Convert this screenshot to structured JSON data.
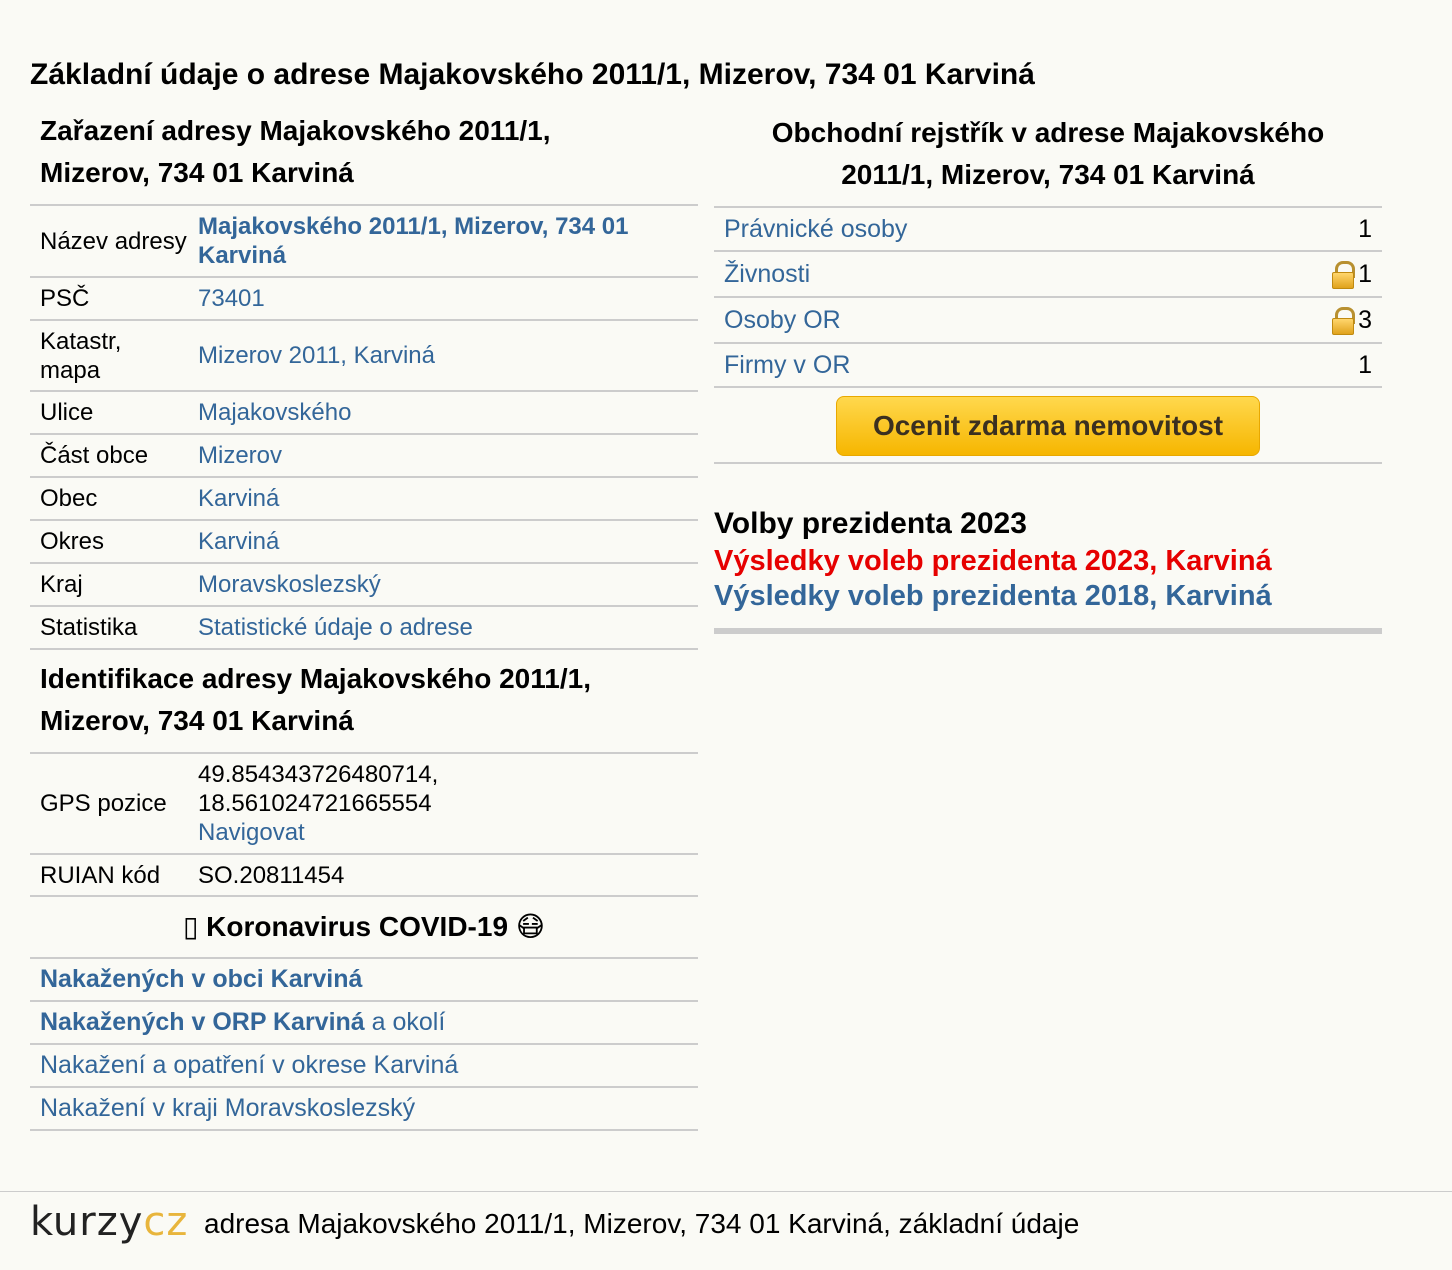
{
  "page_title": "Základní údaje o adrese Majakovského 2011/1, Mizerov, 734 01 Karviná",
  "zarazeni": {
    "heading_line1": "Zařazení adresy Majakovského 2011/1,",
    "heading_line2": "Mizerov, 734 01 Karviná",
    "rows": [
      {
        "label": "Název adresy",
        "value": "Majakovského 2011/1, Mizerov, 734 01 Karviná"
      },
      {
        "label": "PSČ",
        "value": "73401"
      },
      {
        "label": "Katastr, mapa",
        "value": "Mizerov 2011, Karviná"
      },
      {
        "label": "Ulice",
        "value": "Majakovského"
      },
      {
        "label": "Část obce",
        "value": "Mizerov"
      },
      {
        "label": "Obec",
        "value": "Karviná"
      },
      {
        "label": "Okres",
        "value": "Karviná"
      },
      {
        "label": "Kraj",
        "value": "Moravskoslezský"
      },
      {
        "label": "Statistika",
        "value": "Statistické údaje o adrese"
      }
    ]
  },
  "identifikace": {
    "heading_line1": "Identifikace adresy Majakovského 2011/1,",
    "heading_line2": "Mizerov, 734 01 Karviná",
    "gps_label": "GPS pozice",
    "gps_lat": "49.854343726480714,",
    "gps_lon": "18.561024721665554",
    "gps_nav": "Navigovat",
    "ruian_label": "RUIAN kód",
    "ruian_value": "SO.20811454"
  },
  "covid": {
    "heading": "Koronavirus COVID-19",
    "prefix_glyph": "▯",
    "mask_emoji": "😷",
    "links": [
      {
        "bold": "Nakažených v obci Karviná",
        "normal": ""
      },
      {
        "bold": "Nakažených v ORP Karviná",
        "normal": " a okolí"
      },
      {
        "bold": "",
        "normal": "Nakažení a opatření v okrese Karviná"
      },
      {
        "bold": "",
        "normal": "Nakažení v kraji Moravskoslezský"
      }
    ]
  },
  "rejstrik": {
    "heading_line1": "Obchodní rejstřík v adrese Majakovského",
    "heading_line2": "2011/1, Mizerov, 734 01 Karviná",
    "rows": [
      {
        "name": "Právnické osoby",
        "count": "1",
        "locked": false
      },
      {
        "name": "Živnosti",
        "count": "1",
        "locked": true
      },
      {
        "name": "Osoby OR",
        "count": "3",
        "locked": true
      },
      {
        "name": "Firmy v OR",
        "count": "1",
        "locked": false
      }
    ],
    "cta_label": "Ocenit zdarma nemovitost"
  },
  "volby": {
    "title": "Volby prezidenta 2023",
    "link_2023": "Výsledky voleb prezidenta 2023, Karviná",
    "link_2018": "Výsledky voleb prezidenta 2018, Karviná"
  },
  "footer": {
    "logo_kurzy": "kurzy",
    "logo_cz": "cz",
    "text": "adresa Majakovského 2011/1, Mizerov, 734 01 Karviná, základní údaje"
  },
  "colors": {
    "link": "#336699",
    "highlight_link": "#e60000",
    "cta": "#f6b600",
    "divider": "#cccccc",
    "background": "#fafaf5"
  }
}
